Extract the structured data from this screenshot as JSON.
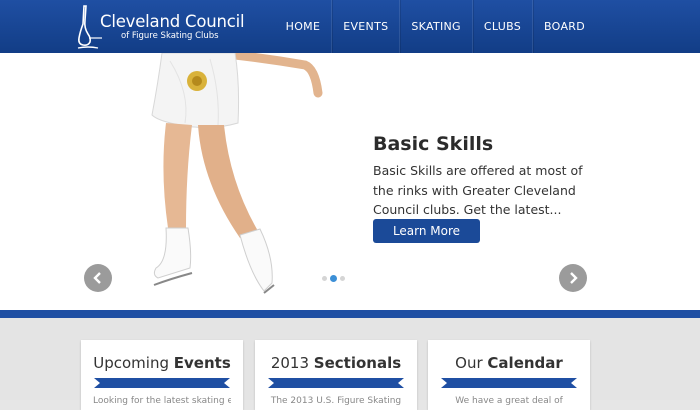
{
  "brand": {
    "title": "Cleveland Council",
    "subtitle": "of Figure Skating Clubs"
  },
  "nav": {
    "items": [
      "HOME",
      "EVENTS",
      "SKATING",
      "CLUBS",
      "BOARD"
    ]
  },
  "hero": {
    "title": "Basic Skills",
    "text": "Basic Skills are offered at most of the rinks with Greater Cleveland Council clubs. Get the latest...",
    "button_label": "Learn More",
    "slide_count": 3,
    "active_slide": 2
  },
  "cards": [
    {
      "title_light": "Upcoming ",
      "title_bold": "Events",
      "text": "Looking for the latest skating events"
    },
    {
      "title_light": "2013 ",
      "title_bold": "Sectionals",
      "text": "The 2013 U.S. Figure Skating"
    },
    {
      "title_light": "Our ",
      "title_bold": "Calendar",
      "text": "We have a great deal of"
    }
  ],
  "colors": {
    "brand_blue": "#1f4fa3",
    "button_blue": "#1b4a98",
    "active_dot": "#3c8fd6"
  }
}
